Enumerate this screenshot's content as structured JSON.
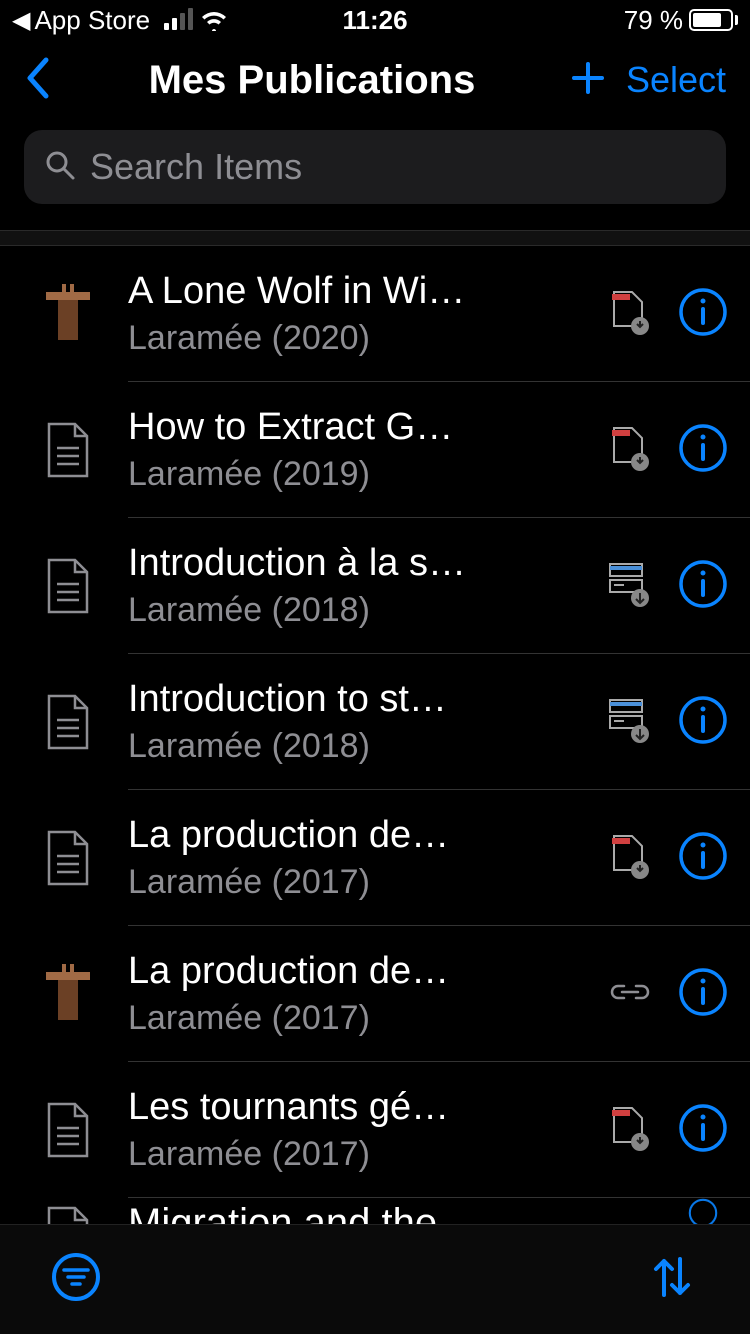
{
  "status": {
    "breadcrumb": "App Store",
    "time": "11:26",
    "battery_text": "79 %",
    "battery_pct": 79
  },
  "nav": {
    "title": "Mes Publications",
    "select_label": "Select"
  },
  "search": {
    "placeholder": "Search Items"
  },
  "items": [
    {
      "icon": "podium",
      "title": "A Lone Wolf in Wi…",
      "subtitle": "Laramée (2020)",
      "attach": "doc-red"
    },
    {
      "icon": "document",
      "title": "How to Extract G…",
      "subtitle": "Laramée (2019)",
      "attach": "doc-red"
    },
    {
      "icon": "document",
      "title": "Introduction à la s…",
      "subtitle": "Laramée (2018)",
      "attach": "server"
    },
    {
      "icon": "document",
      "title": "Introduction to st…",
      "subtitle": "Laramée (2018)",
      "attach": "server"
    },
    {
      "icon": "document",
      "title": "La production de…",
      "subtitle": "Laramée (2017)",
      "attach": "doc-red"
    },
    {
      "icon": "podium",
      "title": "La production de…",
      "subtitle": "Laramée (2017)",
      "attach": "link"
    },
    {
      "icon": "document",
      "title": "Les tournants gé…",
      "subtitle": "Laramée (2017)",
      "attach": "doc-red"
    }
  ],
  "partial_item": {
    "title": "Migration and the"
  },
  "colors": {
    "accent": "#0a84ff",
    "gray": "#8e8e93",
    "podium": "#a06a45"
  },
  "icons": {
    "podium": "podium-icon",
    "document": "document-icon",
    "doc-red": "attachment-doc-icon",
    "server": "attachment-server-icon",
    "link": "attachment-link-icon",
    "info": "info-icon",
    "filter": "filter-icon",
    "sort": "sort-icon",
    "add": "add-icon",
    "back": "back-icon",
    "search": "search-icon"
  }
}
